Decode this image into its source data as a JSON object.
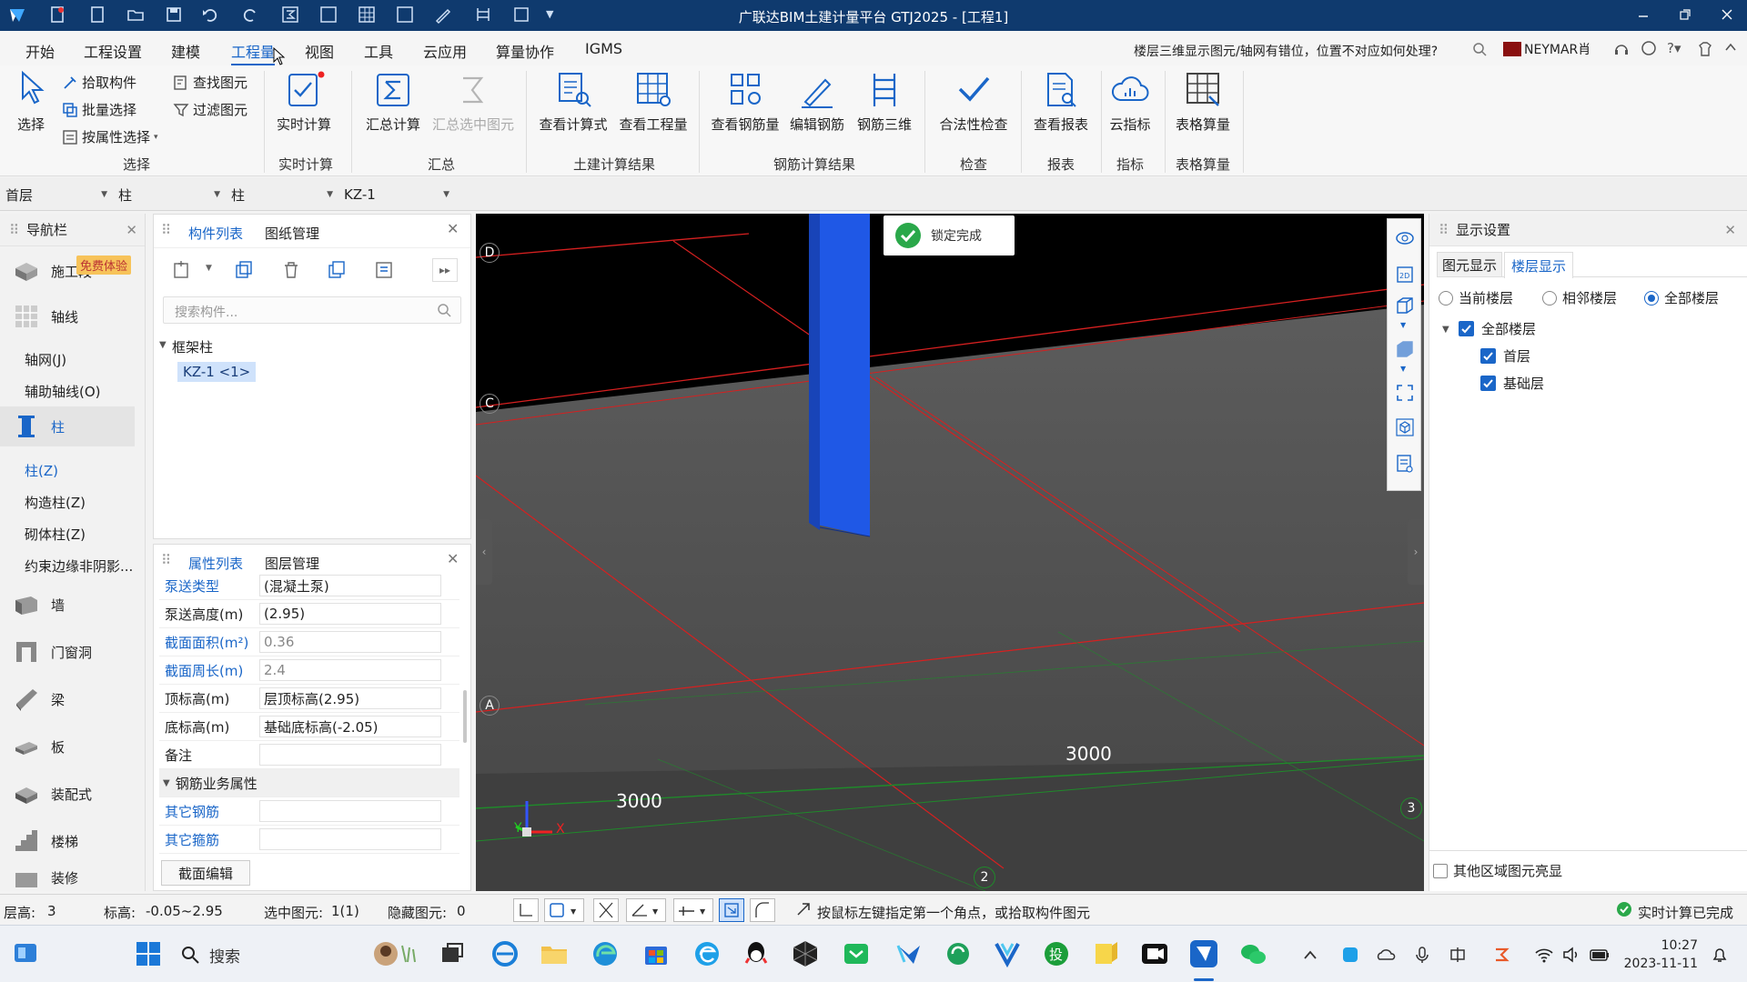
{
  "window": {
    "title": "广联达BIM土建计量平台 GTJ2025 - [工程1]"
  },
  "menu": {
    "items": [
      "开始",
      "工程设置",
      "建模",
      "工程量",
      "视图",
      "工具",
      "云应用",
      "算量协作",
      "IGMS"
    ],
    "active": "工程量",
    "help_question": "楼层三维显示图元/轴网有错位，位置不对应如何处理?",
    "user": "NEYMAR肖"
  },
  "ribbon": {
    "select": {
      "big": "选择",
      "small": [
        "拾取构件",
        "批量选择",
        "按属性选择",
        "查找图元",
        "过滤图元"
      ],
      "group": "选择"
    },
    "realtime": {
      "big": "实时计算",
      "group": "实时计算"
    },
    "summary": {
      "items": [
        "汇总计算",
        "汇总选中图元"
      ],
      "group": "汇总"
    },
    "civil": {
      "items": [
        "查看计算式",
        "查看工程量"
      ],
      "group": "土建计算结果"
    },
    "rebar": {
      "items": [
        "查看钢筋量",
        "编辑钢筋",
        "钢筋三维"
      ],
      "group": "钢筋计算结果"
    },
    "check": {
      "items": [
        "合法性检查"
      ],
      "group": "检查"
    },
    "report": {
      "items": [
        "查看报表"
      ],
      "group": "报表"
    },
    "index": {
      "items": [
        "云指标"
      ],
      "group": "指标"
    },
    "table": {
      "items": [
        "表格算量"
      ],
      "group": "表格算量"
    }
  },
  "selectors": [
    "首层",
    "柱",
    "柱",
    "KZ-1"
  ],
  "nav": {
    "title": "导航栏",
    "badge": "免费体验",
    "items": [
      {
        "label": "施工段",
        "type": "major"
      },
      {
        "label": "轴线",
        "type": "major"
      },
      {
        "label": "轴网(J)",
        "type": "sub"
      },
      {
        "label": "辅助轴线(O)",
        "type": "sub"
      },
      {
        "label": "柱",
        "type": "major-active"
      },
      {
        "label": "柱(Z)",
        "type": "sub-active"
      },
      {
        "label": "构造柱(Z)",
        "type": "sub"
      },
      {
        "label": "砌体柱(Z)",
        "type": "sub"
      },
      {
        "label": "约束边缘非阴影...",
        "type": "sub"
      },
      {
        "label": "墙",
        "type": "major"
      },
      {
        "label": "门窗洞",
        "type": "major"
      },
      {
        "label": "梁",
        "type": "major"
      },
      {
        "label": "板",
        "type": "major"
      },
      {
        "label": "装配式",
        "type": "major"
      },
      {
        "label": "楼梯",
        "type": "major"
      },
      {
        "label": "装修",
        "type": "major"
      }
    ]
  },
  "component_panel": {
    "tabs": [
      "构件列表",
      "图纸管理"
    ],
    "search_placeholder": "搜索构件...",
    "tree_group": "框架柱",
    "tree_item": "KZ-1 <1>"
  },
  "property_panel": {
    "tabs": [
      "属性列表",
      "图层管理"
    ],
    "rows": [
      {
        "key": "泵送类型",
        "value": "(混凝土泵)",
        "blue": true,
        "gray": false
      },
      {
        "key": "泵送高度(m)",
        "value": "(2.95)",
        "blue": false,
        "gray": false
      },
      {
        "key": "截面面积(m²)",
        "value": "0.36",
        "blue": true,
        "gray": true
      },
      {
        "key": "截面周长(m)",
        "value": "2.4",
        "blue": true,
        "gray": true
      },
      {
        "key": "顶标高(m)",
        "value": "层顶标高(2.95)",
        "blue": false,
        "gray": false
      },
      {
        "key": "底标高(m)",
        "value": "基础底标高(-2.05)",
        "blue": false,
        "gray": false
      },
      {
        "key": "备注",
        "value": "",
        "blue": false,
        "gray": false
      }
    ],
    "section": "钢筋业务属性",
    "extra_rows": [
      {
        "key": "其它钢筋",
        "value": ""
      },
      {
        "key": "其它箍筋",
        "value": ""
      }
    ],
    "edit_button": "截面编辑"
  },
  "viewport": {
    "toast": "锁定完成",
    "axis_labels_rows": [
      "D",
      "C",
      "A"
    ],
    "axis_labels_cols": [
      "2",
      "3"
    ],
    "dimensions": [
      "3000",
      "3000"
    ],
    "axis_x": "X",
    "axis_y": "Y"
  },
  "display_settings": {
    "title": "显示设置",
    "tabs": [
      "图元显示",
      "楼层显示"
    ],
    "active_tab": "楼层显示",
    "radios": [
      "当前楼层",
      "相邻楼层",
      "全部楼层"
    ],
    "radio_selected": "全部楼层",
    "tree_root": "全部楼层",
    "tree_children": [
      "首层",
      "基础层"
    ],
    "bottom_checkbox": "其他区域图元亮显"
  },
  "status": {
    "floor_height_label": "层高:",
    "floor_height": "3",
    "elevation_label": "标高:",
    "elevation": "-0.05~2.95",
    "selected_label": "选中图元:",
    "selected": "1(1)",
    "hidden_label": "隐藏图元:",
    "hidden": "0",
    "hint": "按鼠标左键指定第一个角点，或拾取构件图元",
    "calc_done": "实时计算已完成"
  },
  "taskbar": {
    "search": "搜索",
    "time": "10:27",
    "date": "2023-11-11"
  },
  "colors": {
    "accent": "#1a66c8",
    "titlebar": "#0f3a6e",
    "column": "#1f58e6",
    "grid_red": "#d62020",
    "grid_green": "#1f8a2a",
    "success": "#2aa84a"
  }
}
